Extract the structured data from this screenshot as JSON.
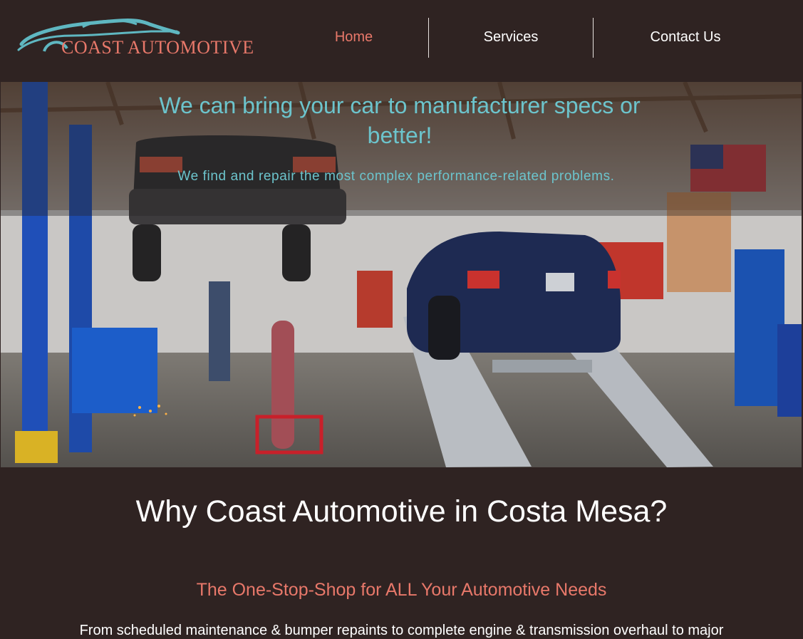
{
  "header": {
    "logo_text": "COAST AUTOMOTIVE",
    "nav": [
      {
        "label": "Home",
        "active": true
      },
      {
        "label": "Services",
        "active": false
      },
      {
        "label": "Contact Us",
        "active": false
      }
    ]
  },
  "hero": {
    "headline": "We can bring your car to manufacturer specs or better!",
    "subheadline": "We find and repair the most complex performance-related problems."
  },
  "main": {
    "title": "Why Coast Automotive in Costa Mesa?",
    "subtitle": "The One-Stop-Shop for ALL Your Automotive Needs",
    "body": "From scheduled maintenance & bumper repaints to complete engine & transmission overhaul to major"
  },
  "colors": {
    "background": "#2f2322",
    "accent": "#e8786a",
    "hero_text": "#6cc4cc",
    "logo_swoosh": "#5fb7c1"
  }
}
